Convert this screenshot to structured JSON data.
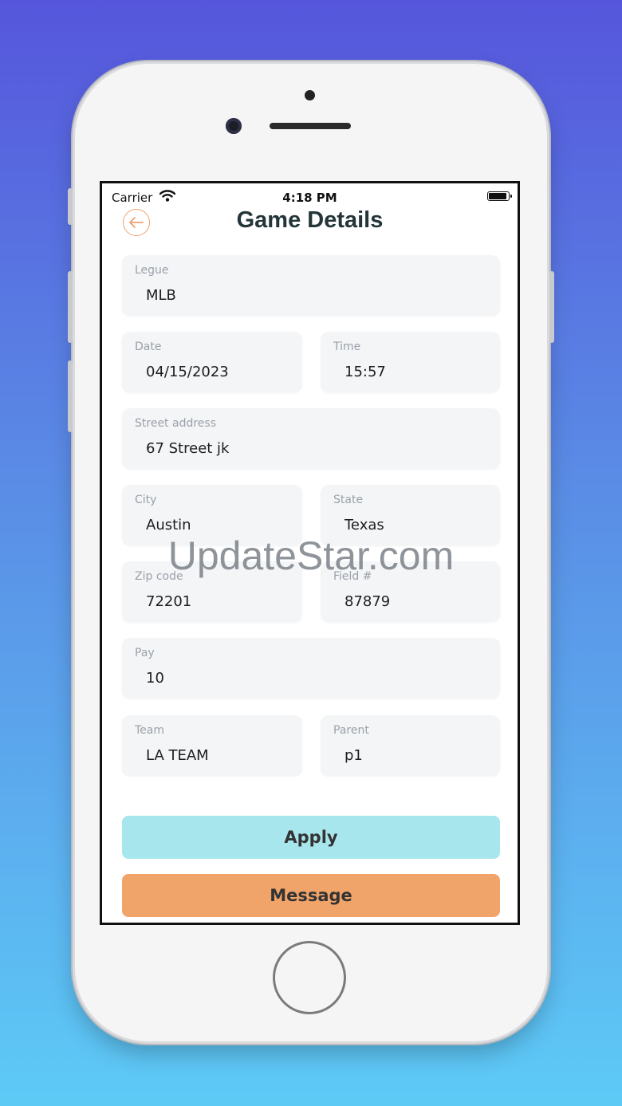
{
  "status_bar": {
    "carrier": "Carrier",
    "time": "4:18 PM"
  },
  "header": {
    "title": "Game Details",
    "back_icon": "arrow-left-icon"
  },
  "fields": {
    "league": {
      "label": "Legue",
      "value": "MLB"
    },
    "date": {
      "label": "Date",
      "value": "04/15/2023"
    },
    "time": {
      "label": "Time",
      "value": "15:57"
    },
    "street": {
      "label": "Street address",
      "value": "67 Street jk"
    },
    "city": {
      "label": "City",
      "value": "Austin"
    },
    "state": {
      "label": "State",
      "value": "Texas"
    },
    "zip": {
      "label": "Zip code",
      "value": "72201"
    },
    "field_no": {
      "label": "Field #",
      "value": "87879"
    },
    "pay": {
      "label": "Pay",
      "value": "10"
    },
    "team": {
      "label": "Team",
      "value": "LA TEAM"
    },
    "parent": {
      "label": "Parent",
      "value": "p1"
    }
  },
  "buttons": {
    "apply": "Apply",
    "message": "Message"
  },
  "watermark": "UpdateStar.com",
  "colors": {
    "accent_orange": "#f0a469",
    "apply_cyan": "#a8e6ee",
    "field_bg": "#f3f5f7"
  }
}
